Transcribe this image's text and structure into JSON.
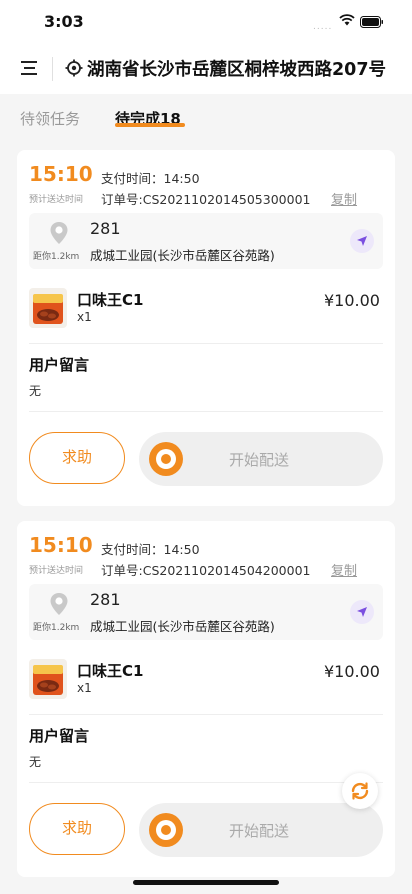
{
  "status_bar": {
    "time": "3:03",
    "signal": "....."
  },
  "header": {
    "address": "湖南省长沙市岳麓区桐梓坡西路207号"
  },
  "tabs": [
    {
      "label": "待领任务"
    },
    {
      "label": "待完成18"
    }
  ],
  "orders": [
    {
      "eta": "15:10",
      "eta_label": "预计送达时间",
      "pay_time": "支付时间：14:50",
      "order_no": "订单号:CS20211020145053​00001",
      "copy_label": "复制",
      "distance": "距你1.2km",
      "addr_num": "281",
      "addr_detail": "成城工业园(长沙市岳麓区谷苑路)",
      "product_name": "口味王C1",
      "product_qty": "x1",
      "product_price": "¥10.00",
      "msg_title": "用户留言",
      "msg_text": "无",
      "help_label": "求助",
      "slider_label": "开始配送"
    },
    {
      "eta": "15:10",
      "eta_label": "预计送达时间",
      "pay_time": "支付时间：14:50",
      "order_no": "订单号:CS20211020145042​00001",
      "copy_label": "复制",
      "distance": "距你1.2km",
      "addr_num": "281",
      "addr_detail": "成城工业园(长沙市岳麓区谷苑路)",
      "product_name": "口味王C1",
      "product_qty": "x1",
      "product_price": "¥10.00",
      "msg_title": "用户留言",
      "msg_text": "无",
      "help_label": "求助",
      "slider_label": "开始配送"
    }
  ],
  "colors": {
    "accent": "#f18b1f",
    "nav_purple": "#7b4fe0"
  },
  "icons": [
    "menu-icon",
    "location-icon",
    "pin-icon",
    "navigate-icon",
    "refresh-icon",
    "wifi-icon",
    "battery-icon"
  ]
}
